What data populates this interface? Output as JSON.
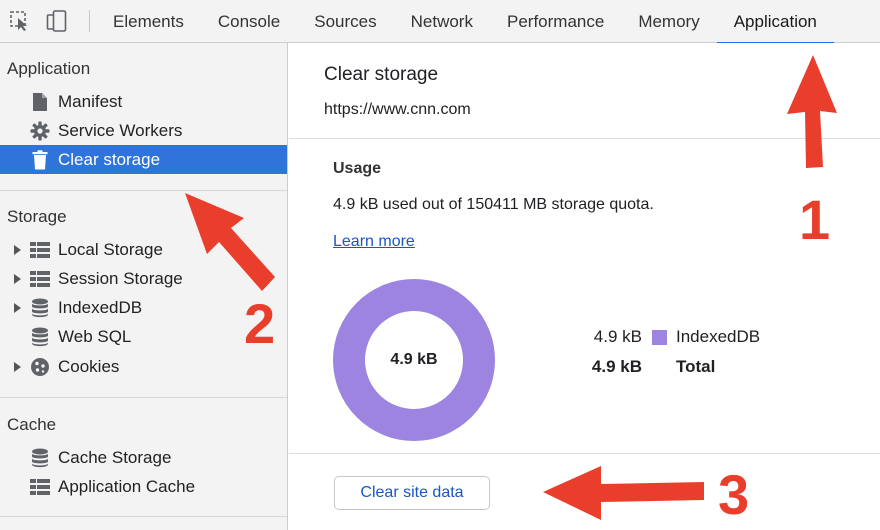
{
  "tabs": [
    {
      "label": "Elements"
    },
    {
      "label": "Console"
    },
    {
      "label": "Sources"
    },
    {
      "label": "Network"
    },
    {
      "label": "Performance"
    },
    {
      "label": "Memory"
    },
    {
      "label": "Application"
    }
  ],
  "active_tab": "Application",
  "sidebar": {
    "application": {
      "title": "Application",
      "items": [
        {
          "label": "Manifest",
          "icon": "file-icon"
        },
        {
          "label": "Service Workers",
          "icon": "gear-icon"
        },
        {
          "label": "Clear storage",
          "icon": "trash-icon",
          "selected": true
        }
      ]
    },
    "storage": {
      "title": "Storage",
      "items": [
        {
          "label": "Local Storage",
          "icon": "grid-icon",
          "expandable": true
        },
        {
          "label": "Session Storage",
          "icon": "grid-icon",
          "expandable": true
        },
        {
          "label": "IndexedDB",
          "icon": "database-icon",
          "expandable": true
        },
        {
          "label": "Web SQL",
          "icon": "database-icon",
          "expandable": false
        },
        {
          "label": "Cookies",
          "icon": "cookie-icon",
          "expandable": true
        }
      ]
    },
    "cache": {
      "title": "Cache",
      "items": [
        {
          "label": "Cache Storage",
          "icon": "database-icon"
        },
        {
          "label": "Application Cache",
          "icon": "grid-icon"
        }
      ]
    }
  },
  "main": {
    "title": "Clear storage",
    "origin": "https://www.cnn.com",
    "usage_heading": "Usage",
    "usage_text": "4.9 kB used out of 150411 MB storage quota.",
    "learn_more": "Learn more",
    "donut_label": "4.9 kB",
    "legend": [
      {
        "size": "4.9 kB",
        "name": "IndexedDB",
        "color": "#9c84e0"
      },
      {
        "size": "4.9 kB",
        "name": "Total",
        "bold": true
      }
    ],
    "clear_button": "Clear site data"
  },
  "annotations": [
    "1",
    "2",
    "3"
  ],
  "colors": {
    "accent": "#1a73e8",
    "selected_bg": "#2f74d8",
    "annotation": "#ea3e2c",
    "donut": "#9c84e0"
  }
}
